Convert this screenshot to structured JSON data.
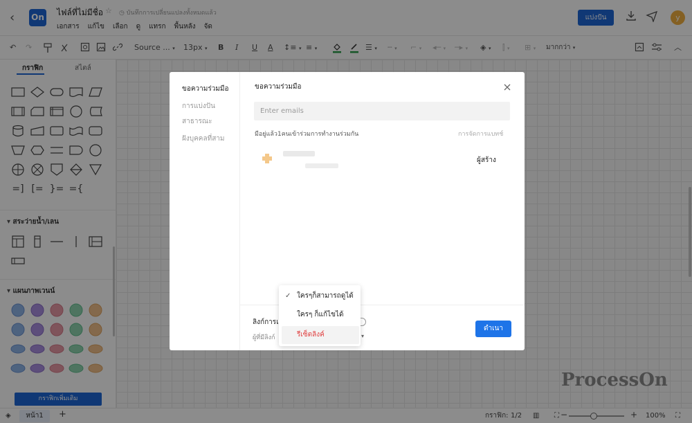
{
  "header": {
    "logo_text": "On",
    "doc_title": "ไฟล์ที่ไม่มีชื่อ",
    "save_status": "บันทึกการเปลี่ยนแปลงทั้งหมดแล้ว",
    "menu": [
      "เอกสาร",
      "แก้ไข",
      "เลือก",
      "ดู",
      "แทรก",
      "พื้นหลัง",
      "จัด"
    ],
    "share_label": "แบ่งปัน",
    "avatar_letter": "y"
  },
  "toolbar": {
    "font_family": "Source ...",
    "font_size": "13px",
    "more_label": "มากกว่า"
  },
  "left_panel": {
    "tabs": [
      "กราฟิก",
      "สไตล์"
    ],
    "section_swimlane": "สระว่ายน้ำ/เลน",
    "section_overview": "แผนภาพเวนน์",
    "more_graphics": "กราฟิกเพิ่มเติม"
  },
  "status_bar": {
    "page_tab": "หน้า1",
    "graphics_label": "กราฟิก:",
    "graphics_count": "1/2",
    "zoom": "100%"
  },
  "watermark": "ProcessOn",
  "modal": {
    "side_items": [
      "ขอความร่วมมือ",
      "การแบ่งปัน",
      "สาธารณะ",
      "ฝังบุคคลที่สาม"
    ],
    "title": "ขอความร่วมมือ",
    "email_placeholder": "Enter emails",
    "collab_count": "มีอยู่แล้ว1คนเข้าร่วมการทำงานร่วมกัน",
    "manage_members": "การจัดการแบทช์",
    "member_role": "ผู้สร้าง",
    "share_link_label": "ลิงก์การแ",
    "link_perm_label": "ผู้ที่มีลิงก์",
    "proceed_label": "ดำเนา"
  },
  "dropdown": {
    "items": [
      "ใครๆก็สามารถดูได้",
      "ใครๆ ก็แก้ไขได้",
      "รีเซ็ตลิงค์"
    ],
    "selected_index": 0
  },
  "colors": {
    "brand_blue": "#1e66d6",
    "reset_red": "#e04040",
    "venn_blue": "#8fb4e8",
    "venn_purple": "#a98fe0",
    "venn_red": "#e89aa6",
    "venn_green": "#8fd4b0",
    "venn_orange": "#f0c08a"
  }
}
